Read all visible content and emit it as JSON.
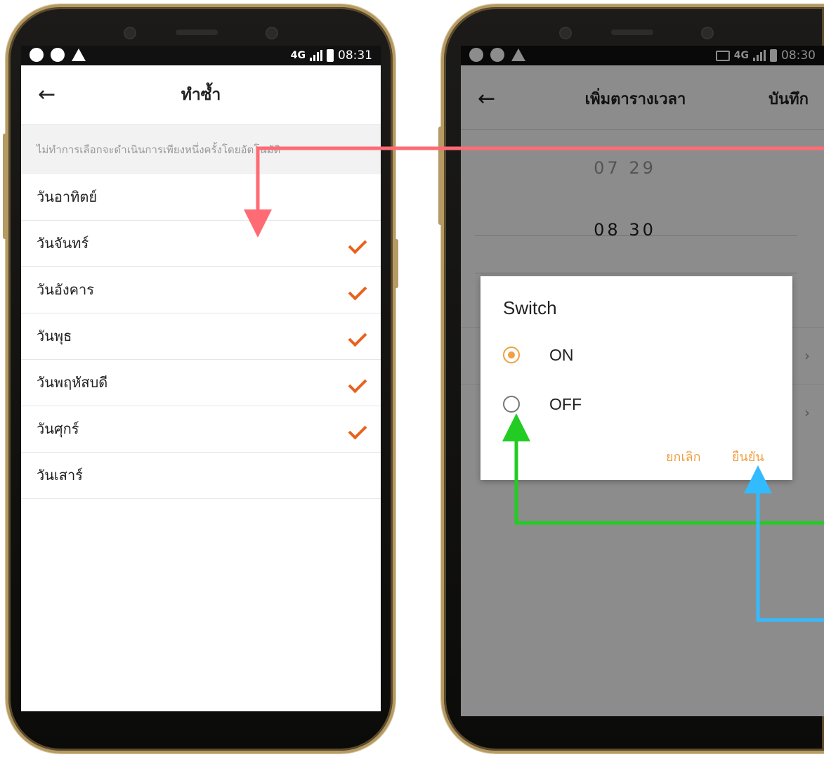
{
  "status_left": {
    "time": "08:31",
    "network": "4G"
  },
  "status_right": {
    "time": "08:30",
    "network": "4G"
  },
  "repeat_screen": {
    "title": "ทำซ้ำ",
    "hint": "ไม่ทำการเลือกจะดำเนินการเพียงหนึ่งครั้งโดยอัตโนมัติ",
    "days": [
      {
        "label": "วันอาทิตย์",
        "checked": false
      },
      {
        "label": "วันจันทร์",
        "checked": true
      },
      {
        "label": "วันอังคาร",
        "checked": true
      },
      {
        "label": "วันพุธ",
        "checked": true
      },
      {
        "label": "วันพฤหัสบดี",
        "checked": true
      },
      {
        "label": "วันศุกร์",
        "checked": true
      },
      {
        "label": "วันเสาร์",
        "checked": false
      }
    ]
  },
  "schedule_screen": {
    "title": "เพิ่มตารางเวลา",
    "save_label": "บันทึก",
    "picker_prev_hour": "07",
    "picker_prev_minute": "29",
    "picker_hour": "08",
    "picker_minute": "30"
  },
  "switch_dialog": {
    "title": "Switch",
    "options": [
      {
        "label": "ON",
        "selected": true
      },
      {
        "label": "OFF",
        "selected": false
      }
    ],
    "cancel_label": "ยกเลิก",
    "confirm_label": "ยืนยัน"
  },
  "colors": {
    "check": "#e8621e",
    "dialog_accent": "#f0a044",
    "arrow_red": "#ff6b74",
    "arrow_green": "#22cc22",
    "arrow_blue": "#33bbff"
  }
}
